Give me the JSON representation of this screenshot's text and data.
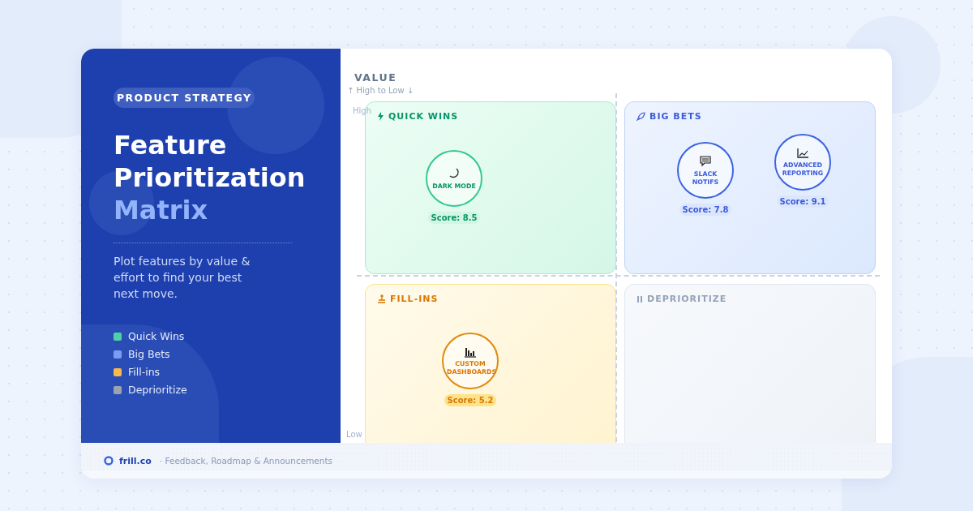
{
  "sidebar": {
    "tag": "PRODUCT STRATEGY",
    "title_lines": [
      "Feature",
      "Prioritization"
    ],
    "title_accent": "Matrix",
    "description": "Plot features by value & effort to find your best next move.",
    "legend": [
      {
        "label": "Quick Wins",
        "color": "#4fd1a5"
      },
      {
        "label": "Big Bets",
        "color": "#7c9cf0"
      },
      {
        "label": "Fill-ins",
        "color": "#f6b94c"
      },
      {
        "label": "Deprioritize",
        "color": "#9ca3af"
      }
    ]
  },
  "axis": {
    "title": "VALUE",
    "subtitle": "↑ High to Low ↓",
    "high": "High",
    "low": "Low"
  },
  "quadrants": [
    {
      "kind": "quick-wins",
      "title": "QUICK WINS",
      "features": [
        {
          "name": "DARK MODE",
          "score": "Score: 8.5"
        }
      ]
    },
    {
      "kind": "big-bets",
      "title": "BIG BETS",
      "features": [
        {
          "name": "SLACK NOTIFS",
          "score": "Score: 7.8"
        },
        {
          "name": "ADVANCED REPORTING",
          "score": "Score: 9.1"
        }
      ]
    },
    {
      "kind": "fill-ins",
      "title": "FILL-INS",
      "features": [
        {
          "name": "CUSTOM DASHBOARDS",
          "score": "Score: 5.2"
        }
      ]
    },
    {
      "kind": "deprioritize",
      "title": "DEPRIORITIZE"
    }
  ],
  "footer": {
    "brand": "frill.co",
    "tagline": "· Feedback, Roadmap & Announcements"
  }
}
